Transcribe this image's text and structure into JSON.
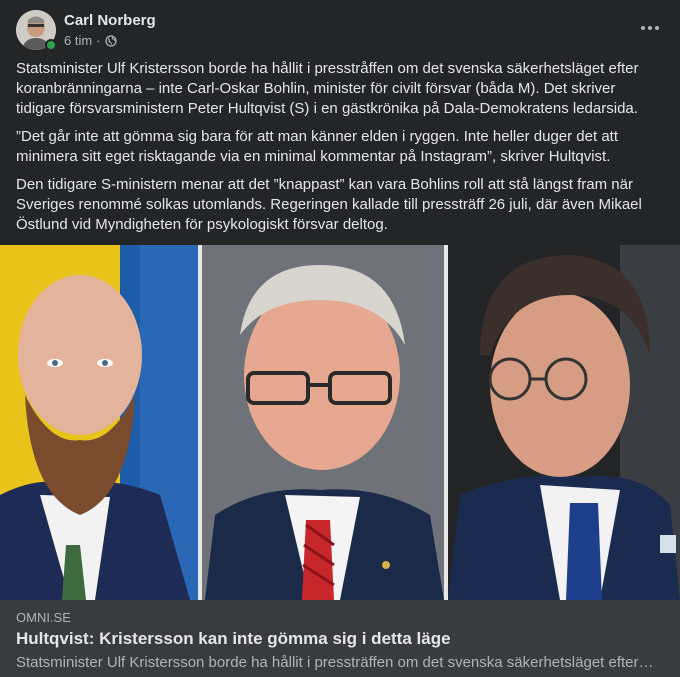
{
  "post": {
    "author": "Carl Norberg",
    "timestamp": "6 tim",
    "separator": "·",
    "audience_icon": "globe-icon",
    "more_icon": "more-options-icon",
    "paragraphs": [
      "Statsminister Ulf Kristersson borde ha hållit i presstråffen om det svenska säkerhetsläget efter koranbränningarna – inte Carl-Oskar Bohlin, minister för civilt försvar (båda M). Det skriver tidigare försvarsministern Peter Hultqvist (S) i en gästkrönika på Dala-Demokratens ledarsida.",
      "”Det går inte att gömma sig bara för att man känner elden i ryggen. Inte heller duger det att minimera sitt eget risktagande via en minimal kommentar på Instagram”, skriver Hultqvist.",
      "Den tidigare S-ministern menar att det ”knappast” kan vara Bohlins roll att stå längst fram när Sveriges renommé solkas utomlands. Regeringen kallade till pressträff 26 juli, där även Mikael Östlund vid Myndigheten för psykologiskt försvar deltog."
    ]
  },
  "link_preview": {
    "domain": "OMNI.SE",
    "title": "Hultqvist: Kristersson kan inte gömma sig i detta läge",
    "description": "Statsminister Ulf Kristersson borde ha hållit i pressträffen om det svenska säkerhetsläget efter koranbränningarna"
  },
  "colors": {
    "background": "#242526",
    "preview_background": "#3a3b3c",
    "primary_text": "#e4e6eb",
    "secondary_text": "#b0b3b8",
    "online": "#31a24c"
  }
}
